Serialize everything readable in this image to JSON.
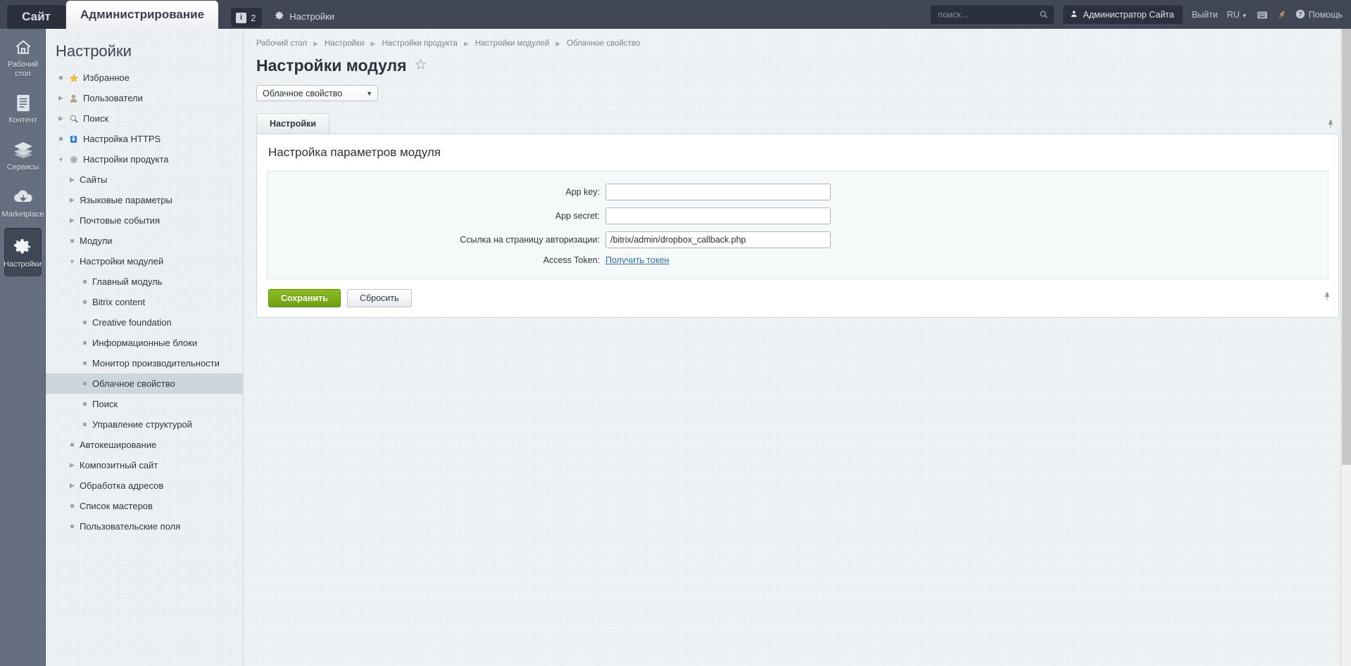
{
  "topbar": {
    "tab_site": "Сайт",
    "tab_admin": "Администрирование",
    "notify_count": "2",
    "notify_icon": "info-icon",
    "settings_label": "Настройки",
    "settings_icon": "gear-icon",
    "search_placeholder": "поиск...",
    "search_value": "",
    "search_icon": "search-icon",
    "user_name": "Администратор Сайта",
    "user_icon": "user-icon",
    "logout_label": "Выйти",
    "lang_label": "RU",
    "keyboard_icon": "keyboard-icon",
    "pin_icon": "pin-icon",
    "help_label": "Помощь",
    "help_icon": "question-circle-icon"
  },
  "rail": {
    "items": [
      {
        "label": "Рабочий стол",
        "icon": "home-icon",
        "active": false
      },
      {
        "label": "Контент",
        "icon": "document-icon",
        "active": false
      },
      {
        "label": "Сервисы",
        "icon": "layers-icon",
        "active": false
      },
      {
        "label": "Marketplace",
        "icon": "cloud-download-icon",
        "active": false
      },
      {
        "label": "Настройки",
        "icon": "gear-icon",
        "active": true
      }
    ]
  },
  "menu": {
    "title": "Настройки",
    "items": [
      {
        "label": "Избранное",
        "marker": "bullet",
        "icon": "star-icon",
        "level": 1,
        "selected": false
      },
      {
        "label": "Пользователи",
        "marker": "arrow-right",
        "icon": "user-icon",
        "level": 1,
        "selected": false
      },
      {
        "label": "Поиск",
        "marker": "arrow-right",
        "icon": "magnifier-icon",
        "level": 1,
        "selected": false
      },
      {
        "label": "Настройка HTTPS",
        "marker": "bullet",
        "icon": "lock-icon",
        "level": 1,
        "selected": false
      },
      {
        "label": "Настройки продукта",
        "marker": "arrow-down",
        "icon": "gear-icon",
        "level": 1,
        "selected": false
      },
      {
        "label": "Сайты",
        "marker": "arrow-right",
        "icon": "",
        "level": 2,
        "selected": false
      },
      {
        "label": "Языковые параметры",
        "marker": "arrow-right",
        "icon": "",
        "level": 2,
        "selected": false
      },
      {
        "label": "Почтовые события",
        "marker": "arrow-right",
        "icon": "",
        "level": 2,
        "selected": false
      },
      {
        "label": "Модули",
        "marker": "bullet",
        "icon": "",
        "level": 2,
        "selected": false
      },
      {
        "label": "Настройки модулей",
        "marker": "arrow-down",
        "icon": "",
        "level": 2,
        "selected": false
      },
      {
        "label": "Главный модуль",
        "marker": "bullet",
        "icon": "",
        "level": 3,
        "selected": false
      },
      {
        "label": "Bitrix content",
        "marker": "bullet",
        "icon": "",
        "level": 3,
        "selected": false
      },
      {
        "label": "Creative foundation",
        "marker": "bullet",
        "icon": "",
        "level": 3,
        "selected": false
      },
      {
        "label": "Информационные блоки",
        "marker": "bullet",
        "icon": "",
        "level": 3,
        "selected": false
      },
      {
        "label": "Монитор производительности",
        "marker": "bullet",
        "icon": "",
        "level": 3,
        "selected": false
      },
      {
        "label": "Облачное свойство",
        "marker": "bullet",
        "icon": "",
        "level": 3,
        "selected": true
      },
      {
        "label": "Поиск",
        "marker": "bullet",
        "icon": "",
        "level": 3,
        "selected": false
      },
      {
        "label": "Управление структурой",
        "marker": "bullet",
        "icon": "",
        "level": 3,
        "selected": false
      },
      {
        "label": "Автокеширование",
        "marker": "bullet",
        "icon": "",
        "level": 2,
        "selected": false
      },
      {
        "label": "Композитный сайт",
        "marker": "arrow-right",
        "icon": "",
        "level": 2,
        "selected": false
      },
      {
        "label": "Обработка адресов",
        "marker": "arrow-right",
        "icon": "",
        "level": 2,
        "selected": false
      },
      {
        "label": "Список мастеров",
        "marker": "bullet",
        "icon": "",
        "level": 2,
        "selected": false
      },
      {
        "label": "Пользовательские поля",
        "marker": "bullet",
        "icon": "",
        "level": 2,
        "selected": false
      }
    ]
  },
  "main": {
    "breadcrumb": [
      "Рабочий стол",
      "Настройки",
      "Настройки продукта",
      "Настройки модулей",
      "Облачное свойство"
    ],
    "page_title": "Настройки модуля",
    "favorite_icon": "star-outline-icon",
    "module_select_value": "Облачное свойство",
    "tabs": [
      {
        "label": "Настройки",
        "active": true
      }
    ],
    "pin_icon": "pin-icon",
    "panel_title": "Настройка параметров модуля",
    "fields": [
      {
        "label": "App key:",
        "type": "text",
        "value": "",
        "name": "app-key"
      },
      {
        "label": "App secret:",
        "type": "text",
        "value": "",
        "name": "app-secret"
      },
      {
        "label": "Ссылка на страницу авторизации:",
        "type": "text",
        "value": "/bitrix/admin/dropbox_callback.php",
        "name": "auth-page-url"
      },
      {
        "label": "Access Token:",
        "type": "link",
        "value": "Получить токен",
        "name": "access-token"
      }
    ],
    "save_label": "Сохранить",
    "reset_label": "Сбросить"
  },
  "colors": {
    "topbar_bg": "#3f4654",
    "rail_bg": "#646d7e",
    "menu_bg": "#e6edee",
    "menu_selected": "#ccd7db",
    "save_green": "#7cae1a",
    "link_blue": "#2f6fa8"
  }
}
